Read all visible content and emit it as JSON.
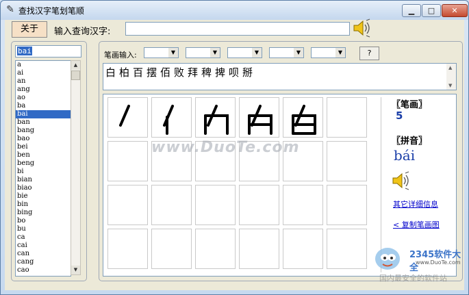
{
  "window": {
    "title": "查找汉字笔划笔顺",
    "min_glyph": "▁",
    "max_glyph": "□",
    "close_glyph": "✕"
  },
  "toolbar": {
    "about_label": "关于",
    "query_label": "输入查询汉字:",
    "query_value": ""
  },
  "left": {
    "search_value": "bai",
    "pinyin_items": [
      "a",
      "ai",
      "an",
      "ang",
      "ao",
      "ba",
      "bai",
      "ban",
      "bang",
      "bao",
      "bei",
      "ben",
      "beng",
      "bi",
      "bian",
      "biao",
      "bie",
      "bin",
      "bing",
      "bo",
      "bu",
      "ca",
      "cai",
      "can",
      "cang",
      "cao"
    ],
    "selected_index": 6
  },
  "stroke_input": {
    "label": "笔画输入:",
    "selects": [
      "",
      "",
      "",
      "",
      ""
    ],
    "help_label": "?"
  },
  "results": {
    "text": "白柏百摆佰败拜稗捭呗掰"
  },
  "info": {
    "strokes_heading": "〖笔画〗",
    "strokes_value": "5",
    "pinyin_heading": "〖拼音〗",
    "pinyin_value": "bái",
    "details_link": "其它详细信息",
    "copy_link": "< 复制笔画图"
  },
  "watermark": {
    "text": "www.DuoTe.com"
  },
  "corner": {
    "brand": "2345软件大全",
    "url": "www.DuoTe.com",
    "slogan": "国内最安全的软件站"
  },
  "icons": {
    "speaker": "speaker-icon",
    "app": "app-icon"
  }
}
